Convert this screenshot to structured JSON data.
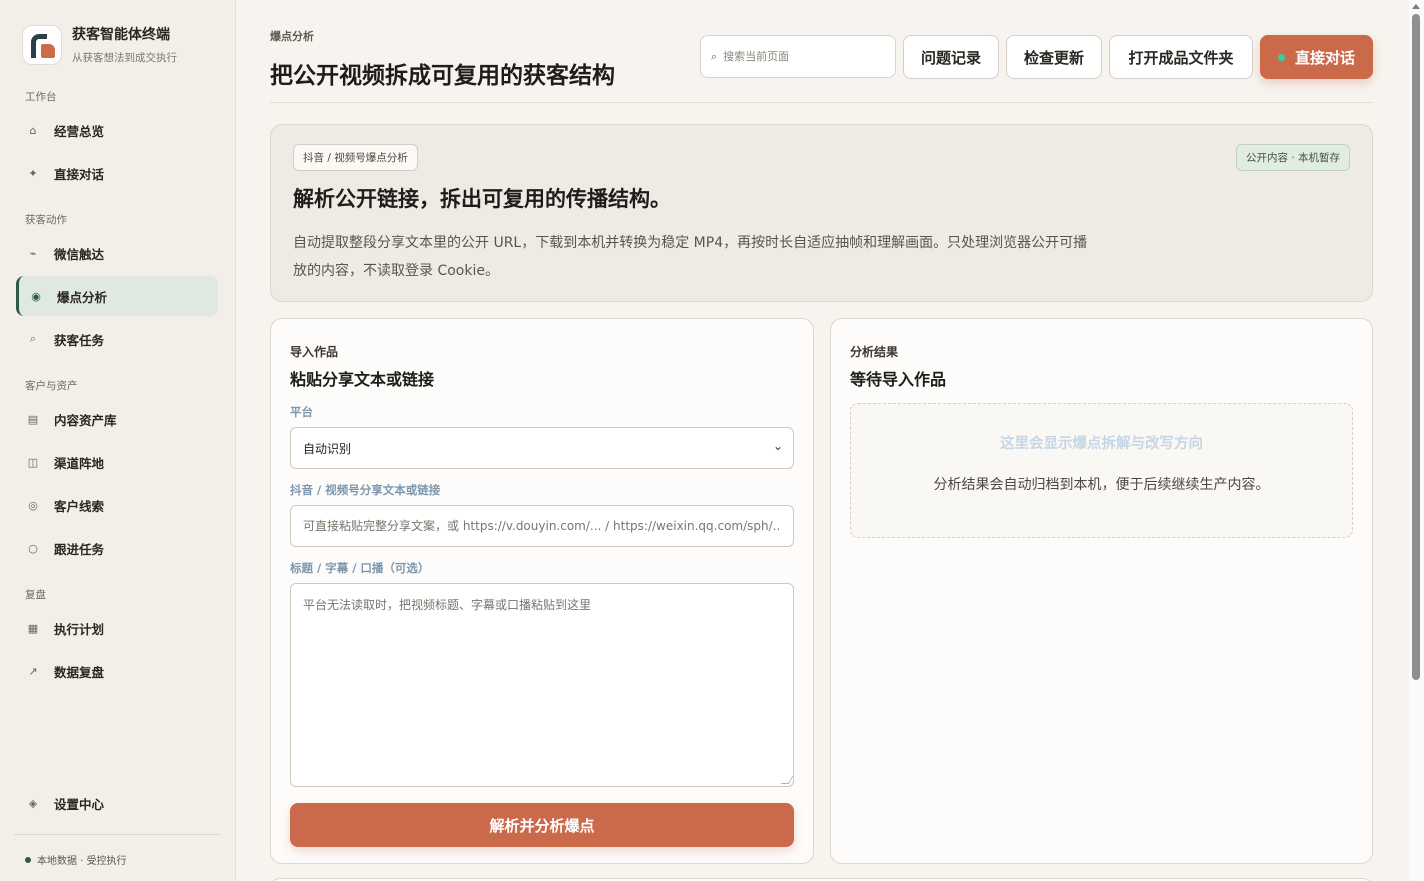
{
  "brand": {
    "title": "获客智能体终端",
    "subtitle": "从获客想法到成交执行"
  },
  "sidebar": {
    "sections": [
      {
        "label": "工作台"
      },
      {
        "label": "获客动作"
      },
      {
        "label": "客户与资产"
      },
      {
        "label": "复盘"
      }
    ],
    "items": [
      {
        "label": "经营总览",
        "icon": "⌂",
        "icon_name": "home-icon"
      },
      {
        "label": "直接对话",
        "icon": "✦",
        "icon_name": "sparkle-icon"
      },
      {
        "label": "微信触达",
        "icon": "⌁",
        "icon_name": "signal-icon"
      },
      {
        "label": "爆点分析",
        "icon": "◉",
        "icon_name": "target-icon",
        "active": true
      },
      {
        "label": "获客任务",
        "icon": "⌕",
        "icon_name": "search-icon"
      },
      {
        "label": "内容资产库",
        "icon": "▤",
        "icon_name": "library-icon"
      },
      {
        "label": "渠道阵地",
        "icon": "◫",
        "icon_name": "columns-icon"
      },
      {
        "label": "客户线索",
        "icon": "◎",
        "icon_name": "lead-icon"
      },
      {
        "label": "跟进任务",
        "icon": "○",
        "icon_name": "circle-icon"
      },
      {
        "label": "执行计划",
        "icon": "▦",
        "icon_name": "grid-icon"
      },
      {
        "label": "数据复盘",
        "icon": "↗",
        "icon_name": "trend-icon"
      }
    ],
    "settings": {
      "label": "设置中心",
      "icon": "◈",
      "icon_name": "settings-icon"
    },
    "footer_status": "本地数据 · 受控执行"
  },
  "header": {
    "eyebrow": "爆点分析",
    "title": "把公开视频拆成可复用的获客结构",
    "search_placeholder": "搜索当前页面",
    "buttons": {
      "issues": "问题记录",
      "update": "检查更新",
      "open_folder": "打开成品文件夹",
      "chat": "直接对话"
    }
  },
  "hero": {
    "tag": "抖音 / 视频号爆点分析",
    "badge": "公开内容 · 本机暂存",
    "title": "解析公开链接，拆出可复用的传播结构。",
    "description": "自动提取整段分享文本里的公开 URL，下载到本机并转换为稳定 MP4，再按时长自适应抽帧和理解画面。只处理浏览器公开可播放的内容，不读取登录 Cookie。"
  },
  "import_card": {
    "eyebrow": "导入作品",
    "title": "粘贴分享文本或链接",
    "platform_label": "平台",
    "platform_value": "自动识别",
    "link_label": "抖音 / 视频号分享文本或链接",
    "link_placeholder": "可直接粘贴完整分享文案，或 https://v.douyin.com/... / https://weixin.qq.com/sph/...",
    "caption_label": "标题 / 字幕 / 口播（可选）",
    "caption_placeholder": "平台无法读取时，把视频标题、字幕或口播粘贴到这里",
    "submit": "解析并分析爆点"
  },
  "result_card": {
    "eyebrow": "分析结果",
    "title": "等待导入作品",
    "empty_title": "这里会显示爆点拆解与改写方向",
    "empty_desc": "分析结果会自动归档到本机，便于后续继续生产内容。"
  },
  "colors": {
    "accent": "#cb6a4b",
    "active_nav": "#e0e9e1",
    "success": "#2f5a43",
    "chat_dot": "#3fc9a9"
  }
}
